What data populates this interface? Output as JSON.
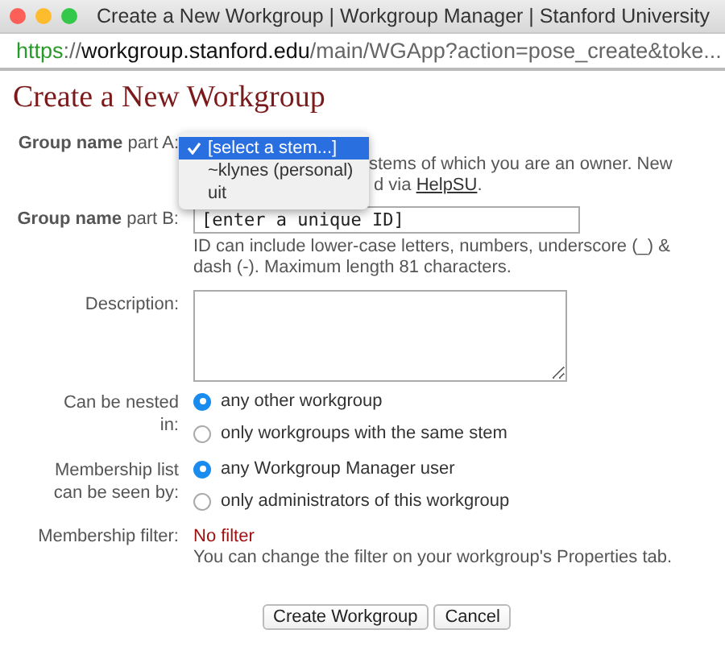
{
  "window": {
    "title": "Create a New Workgroup | Workgroup Manager | Stanford University"
  },
  "address_bar": {
    "scheme": "https",
    "separator": "://",
    "host": "workgroup.stanford.edu",
    "path": "/main/WGApp?action=pose_create&toke..."
  },
  "heading": "Create a New Workgroup",
  "part_a": {
    "label": "**Group name** part A:",
    "dropdown": [
      {
        "label": "[select a stem...]",
        "selected": true
      },
      {
        "label": "~klynes (personal)",
        "selected": false
      },
      {
        "label": "uit",
        "selected": false
      }
    ],
    "help_line_1": "stems of which you are an owner. New",
    "help_line_2": "d via",
    "help_link": "HelpSU",
    "help_end": "."
  },
  "part_b": {
    "label": "**Group name** part B:",
    "value": "[enter a unique ID]",
    "help": "ID can include lower-case letters, numbers, underscore (_) & dash (-). Maximum length 81 characters."
  },
  "description": {
    "label": "Description:"
  },
  "radio_groups": [
    {
      "label": "Can be nested in:",
      "options": [
        {
          "label": "any other workgroup",
          "selected": true
        },
        {
          "label": "only workgroups with the same stem",
          "selected": false
        }
      ]
    },
    {
      "label": "Membership list can be seen by:",
      "options": [
        {
          "label": "any Workgroup Manager user",
          "selected": true
        },
        {
          "label": "only administrators of this workgroup",
          "selected": false
        }
      ]
    }
  ],
  "membership_filter": {
    "label": "Membership filter:",
    "value": "No filter",
    "note": "You can change the filter on your workgroup's Properties tab."
  },
  "buttons": [
    "Create Workgroup",
    "Cancel"
  ]
}
